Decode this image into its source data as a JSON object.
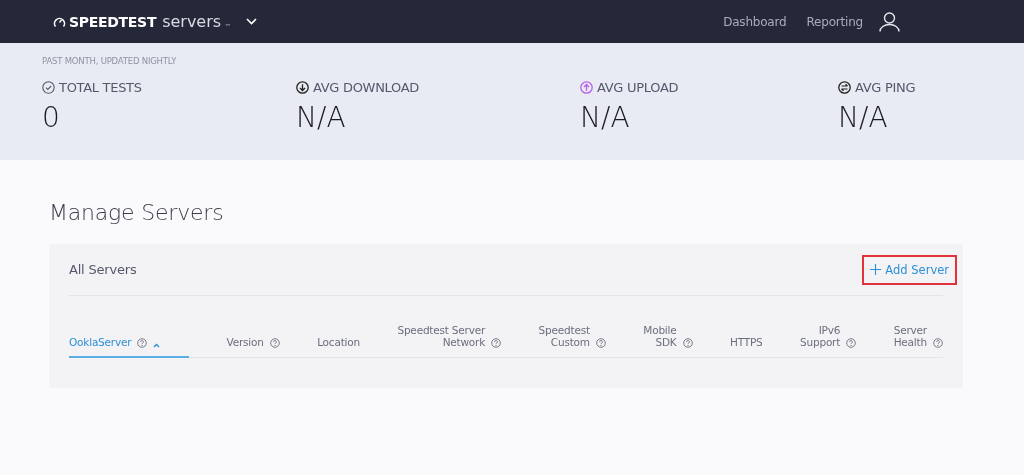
{
  "header": {
    "brand": "SPEEDTEST",
    "product": "servers",
    "trademark": "™",
    "nav": [
      {
        "label": "Dashboard"
      },
      {
        "label": "Reporting"
      }
    ]
  },
  "stats": {
    "caption": "PAST MONTH, UPDATED NIGHTLY",
    "items": [
      {
        "kind": "tests",
        "label": "TOTAL TESTS",
        "value": "0"
      },
      {
        "kind": "download",
        "label": "AVG DOWNLOAD",
        "value": "N/A"
      },
      {
        "kind": "upload",
        "label": "AVG UPLOAD",
        "value": "N/A"
      },
      {
        "kind": "ping",
        "label": "AVG PING",
        "value": "N/A"
      }
    ]
  },
  "page_title": "Manage Servers",
  "panel": {
    "title": "All Servers",
    "add_button": {
      "label": "Add Server",
      "highlighted": true
    },
    "columns": [
      {
        "lines": [
          "OoklaServer"
        ],
        "help": true,
        "selected": true
      },
      {
        "lines": [
          "Version"
        ],
        "help": true,
        "selected": false
      },
      {
        "lines": [
          "Location"
        ],
        "help": false,
        "selected": false
      },
      {
        "lines": [
          "Speedtest Server",
          "Network"
        ],
        "help": true,
        "selected": false
      },
      {
        "lines": [
          "Speedtest",
          "Custom"
        ],
        "help": true,
        "selected": false
      },
      {
        "lines": [
          "Mobile",
          "SDK"
        ],
        "help": true,
        "selected": false
      },
      {
        "lines": [
          "HTTPS"
        ],
        "help": false,
        "selected": false
      },
      {
        "lines": [
          "IPv6",
          "Support"
        ],
        "help": true,
        "selected": false
      },
      {
        "lines": [
          "Server",
          "Health"
        ],
        "help": true,
        "selected": false
      }
    ]
  }
}
